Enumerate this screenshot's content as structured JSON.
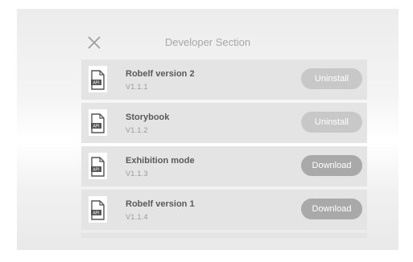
{
  "header": {
    "title": "Developer Section"
  },
  "icons": {
    "close": "close-icon",
    "file": "api-file-icon"
  },
  "items": [
    {
      "name": "Robelf version 2",
      "version": "V1.1.1",
      "action": "Uninstall",
      "file_label": "API"
    },
    {
      "name": "Storybook",
      "version": "V1.1.2",
      "action": "Uninstall",
      "file_label": "API"
    },
    {
      "name": "Exhibition mode",
      "version": "V1.1.3",
      "action": "Download",
      "file_label": "API"
    },
    {
      "name": "Robelf version 1",
      "version": "V1.1.4",
      "action": "Download",
      "file_label": "API"
    }
  ],
  "colors": {
    "row_bg": "#e4e4e4",
    "uninstall_button": "#c8c8c8",
    "download_button": "#a9a9a9"
  }
}
